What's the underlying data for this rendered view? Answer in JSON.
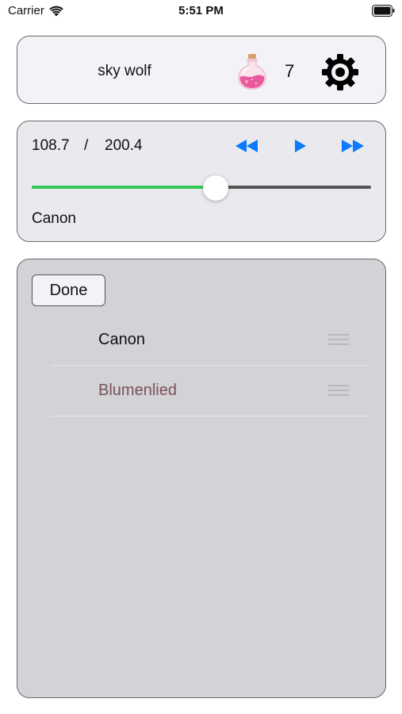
{
  "status_bar": {
    "carrier": "Carrier",
    "time": "5:51 PM",
    "wifi_icon": "wifi-icon",
    "battery_icon": "battery-icon"
  },
  "header": {
    "user_name": "sky wolf",
    "potion_icon": "potion-bottle-icon",
    "potion_count": "7",
    "settings_icon": "gear-icon"
  },
  "player": {
    "current_time": "108.7",
    "separator": "/",
    "total_time": "200.4",
    "progress_fraction": 0.5424,
    "track_title": "Canon",
    "controls": [
      "rewind-icon",
      "play-icon",
      "fast-forward-icon"
    ],
    "accent_color": "#0a7aff",
    "progress_color": "#34c759"
  },
  "playlist": {
    "done_label": "Done",
    "items": [
      {
        "label": "Canon",
        "active": false
      },
      {
        "label": "Blumenlied",
        "active": true
      }
    ],
    "active_color": "#7a5256"
  }
}
